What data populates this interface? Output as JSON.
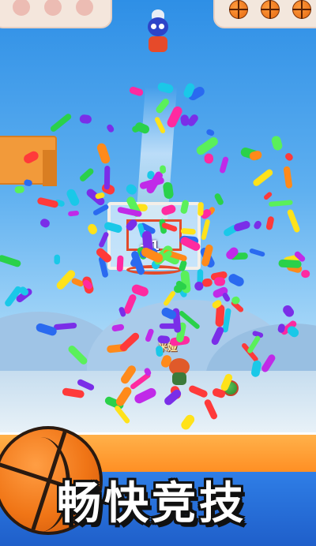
{
  "hud": {
    "balls_remaining": 3,
    "ball_icon": "basketball-icon"
  },
  "game": {
    "score_popup": "+1",
    "opponent_name": "米娅"
  },
  "banner": {
    "slogan": "畅快竞技",
    "icon": "basketball-icon"
  },
  "colors": {
    "sky_top": "#2e8fe6",
    "accent_orange": "#ff8a1e",
    "banner_blue": "#1f5fca",
    "rim_red": "#e24a2a"
  }
}
